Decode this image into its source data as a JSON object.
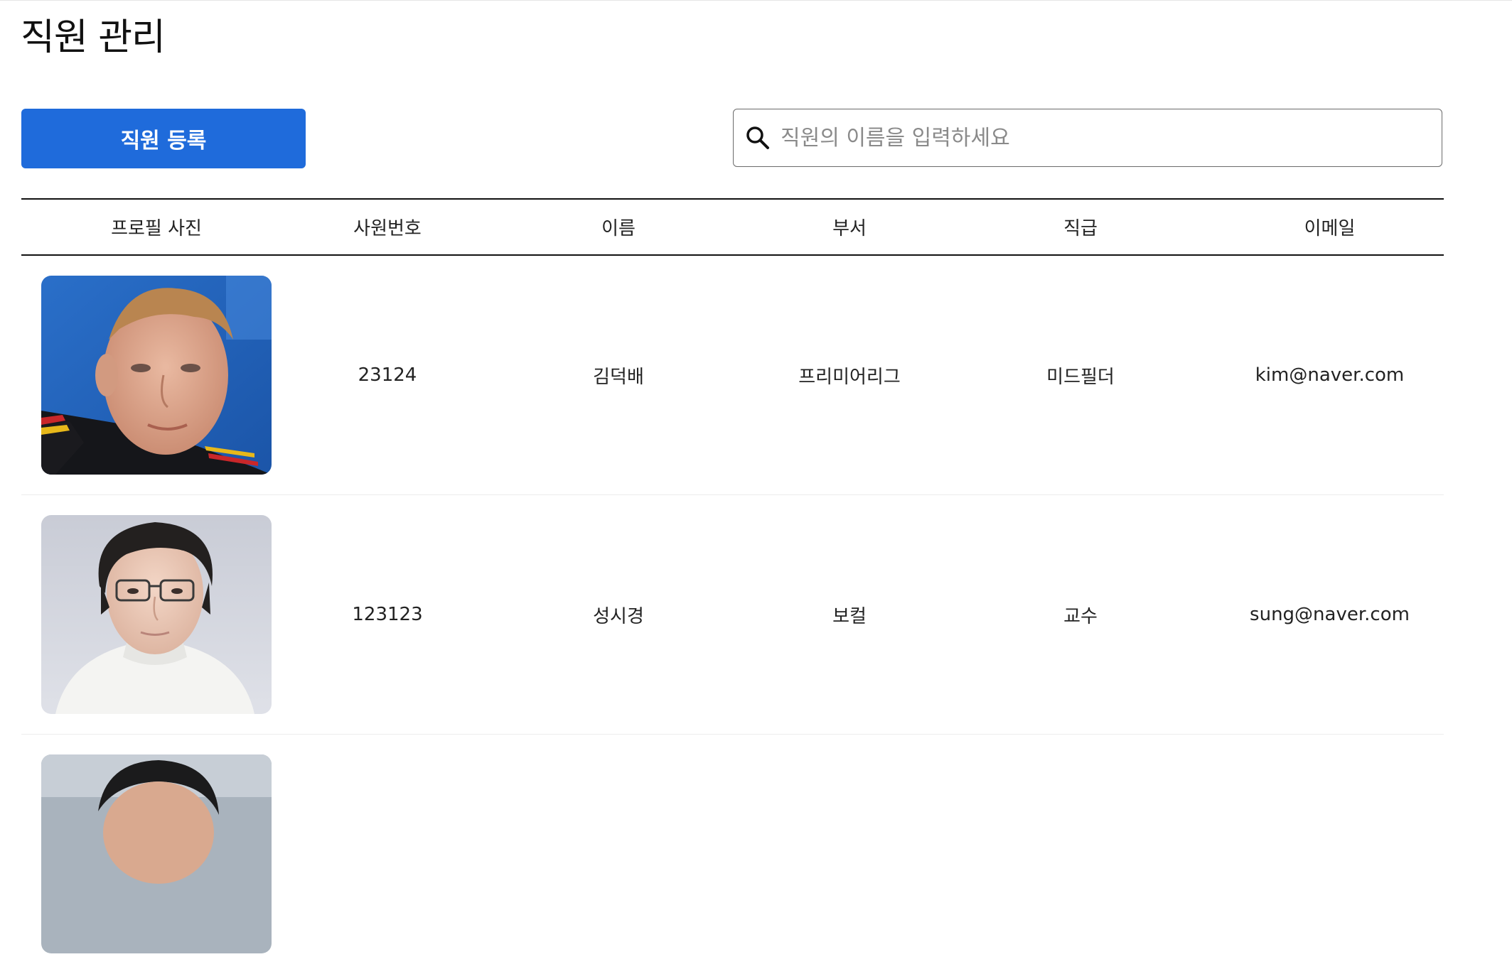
{
  "header": {
    "title": "직원 관리"
  },
  "toolbar": {
    "register_label": "직원 등록",
    "search_placeholder": "직원의 이름을 입력하세요",
    "search_value": ""
  },
  "table": {
    "headers": {
      "photo": "프로필 사진",
      "id": "사원번호",
      "name": "이름",
      "dept": "부서",
      "rank": "직급",
      "email": "이메일"
    },
    "rows": [
      {
        "id": "23124",
        "name": "김덕배",
        "dept": "프리미어리그",
        "rank": "미드필더",
        "email": "kim@naver.com"
      },
      {
        "id": "123123",
        "name": "성시경",
        "dept": "보컬",
        "rank": "교수",
        "email": "sung@naver.com"
      }
    ]
  },
  "colors": {
    "accent": "#1f6bdb",
    "border_dark": "#111111",
    "row_divider": "#ececec"
  },
  "icons": {
    "search": "search-icon"
  }
}
